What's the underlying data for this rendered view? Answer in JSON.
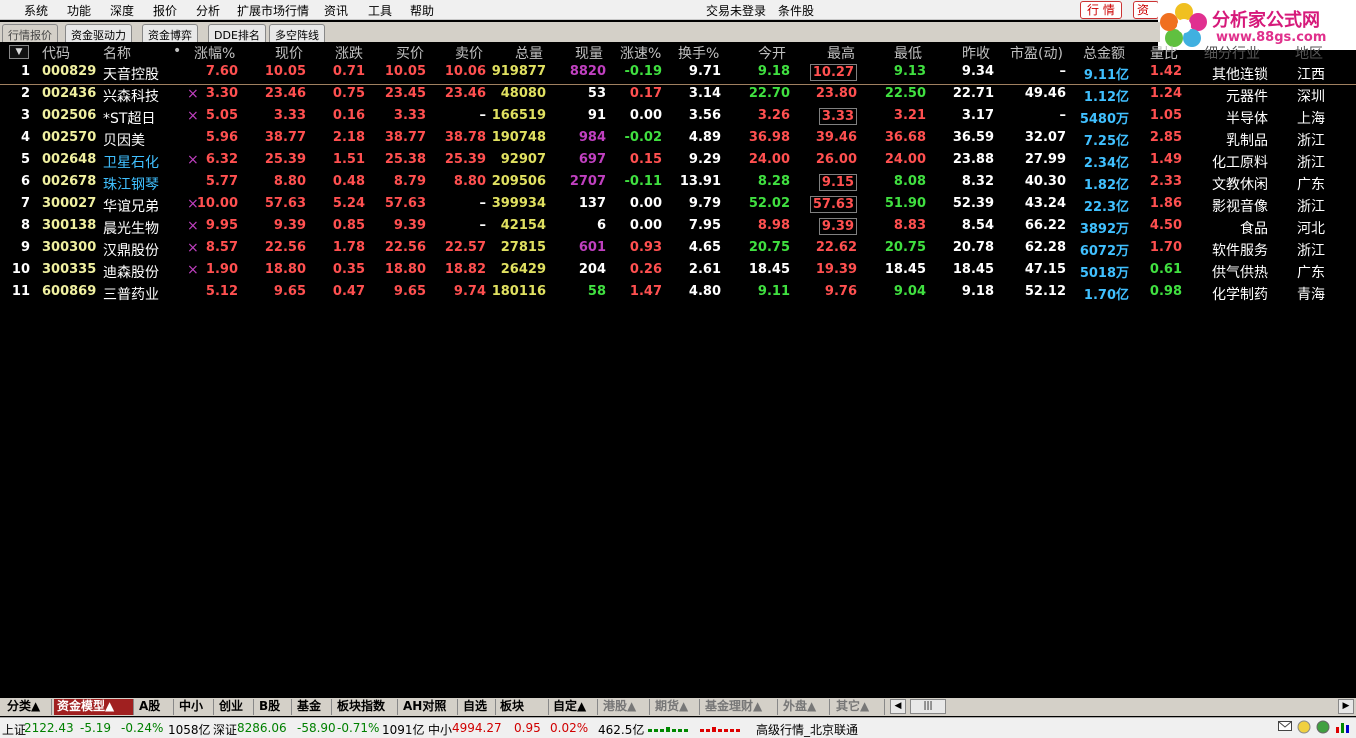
{
  "menu": {
    "items": [
      "系统",
      "功能",
      "深度",
      "报价",
      "分析",
      "扩展市场行情",
      "资讯",
      "工具",
      "帮助"
    ],
    "center_left": "交易未登录",
    "center_right": "条件股",
    "btn_quote": "行 情",
    "btn_info": "资"
  },
  "logo": {
    "title": "分析家公式网",
    "url": "www.88gs.com"
  },
  "tabs": [
    "行情报价",
    "资金驱动力",
    "资金博弈",
    "DDE排名",
    "多空阵线"
  ],
  "columns": [
    "代码",
    "名称",
    "•",
    "涨幅%",
    "现价",
    "涨跌",
    "买价",
    "卖价",
    "总量",
    "现量",
    "涨速%",
    "换手%",
    "今开",
    "最高",
    "最低",
    "昨收",
    "市盈(动)",
    "总金额",
    "量比",
    "细分行业",
    "地区"
  ],
  "sort_icon": "sort-desc-icon",
  "rows": [
    {
      "n": "1",
      "code": "000829",
      "name": "天音控股",
      "mark": "",
      "chg": "7.60",
      "price": "10.05",
      "diff": "0.71",
      "bid": "10.05",
      "ask": "10.06",
      "vol": "919877",
      "cur": "8820",
      "spd": "-0.19",
      "turn": "9.71",
      "open": "9.18",
      "high": "10.27",
      "low": "9.13",
      "prev": "9.34",
      "pe": "–",
      "amt": "9.11亿",
      "ratio": "1.42",
      "ind": "其他连锁",
      "area": "江西"
    },
    {
      "n": "2",
      "code": "002436",
      "name": "兴森科技",
      "mark": "×",
      "chg": "3.30",
      "price": "23.46",
      "diff": "0.75",
      "bid": "23.45",
      "ask": "23.46",
      "vol": "48080",
      "cur": "53",
      "spd": "0.17",
      "turn": "3.14",
      "open": "22.70",
      "high": "23.80",
      "low": "22.50",
      "prev": "22.71",
      "pe": "49.46",
      "amt": "1.12亿",
      "ratio": "1.24",
      "ind": "元器件",
      "area": "深圳"
    },
    {
      "n": "3",
      "code": "002506",
      "name": "*ST超日",
      "mark": "×",
      "chg": "5.05",
      "price": "3.33",
      "diff": "0.16",
      "bid": "3.33",
      "ask": "–",
      "vol": "166519",
      "cur": "91",
      "spd": "0.00",
      "turn": "3.56",
      "open": "3.26",
      "high": "3.33",
      "low": "3.21",
      "prev": "3.17",
      "pe": "–",
      "amt": "5480万",
      "ratio": "1.05",
      "ind": "半导体",
      "area": "上海"
    },
    {
      "n": "4",
      "code": "002570",
      "name": "贝因美",
      "mark": "",
      "chg": "5.96",
      "price": "38.77",
      "diff": "2.18",
      "bid": "38.77",
      "ask": "38.78",
      "vol": "190748",
      "cur": "984",
      "spd": "-0.02",
      "turn": "4.89",
      "open": "36.98",
      "high": "39.46",
      "low": "36.68",
      "prev": "36.59",
      "pe": "32.07",
      "amt": "7.25亿",
      "ratio": "2.85",
      "ind": "乳制品",
      "area": "浙江"
    },
    {
      "n": "5",
      "code": "002648",
      "name": "卫星石化",
      "mark": "×",
      "chg": "6.32",
      "price": "25.39",
      "diff": "1.51",
      "bid": "25.38",
      "ask": "25.39",
      "vol": "92907",
      "cur": "697",
      "spd": "0.15",
      "turn": "9.29",
      "open": "24.00",
      "high": "26.00",
      "low": "24.00",
      "prev": "23.88",
      "pe": "27.99",
      "amt": "2.34亿",
      "ratio": "1.49",
      "ind": "化工原料",
      "area": "浙江"
    },
    {
      "n": "6",
      "code": "002678",
      "name": "珠江钢琴",
      "mark": "",
      "chg": "5.77",
      "price": "8.80",
      "diff": "0.48",
      "bid": "8.79",
      "ask": "8.80",
      "vol": "209506",
      "cur": "2707",
      "spd": "-0.11",
      "turn": "13.91",
      "open": "8.28",
      "high": "9.15",
      "low": "8.08",
      "prev": "8.32",
      "pe": "40.30",
      "amt": "1.82亿",
      "ratio": "2.33",
      "ind": "文教休闲",
      "area": "广东"
    },
    {
      "n": "7",
      "code": "300027",
      "name": "华谊兄弟",
      "mark": "×",
      "chg": "10.00",
      "price": "57.63",
      "diff": "5.24",
      "bid": "57.63",
      "ask": "–",
      "vol": "399934",
      "cur": "137",
      "spd": "0.00",
      "turn": "9.79",
      "open": "52.02",
      "high": "57.63",
      "low": "51.90",
      "prev": "52.39",
      "pe": "43.24",
      "amt": "22.3亿",
      "ratio": "1.86",
      "ind": "影视音像",
      "area": "浙江"
    },
    {
      "n": "8",
      "code": "300138",
      "name": "晨光生物",
      "mark": "×",
      "chg": "9.95",
      "price": "9.39",
      "diff": "0.85",
      "bid": "9.39",
      "ask": "–",
      "vol": "42154",
      "cur": "6",
      "spd": "0.00",
      "turn": "7.95",
      "open": "8.98",
      "high": "9.39",
      "low": "8.83",
      "prev": "8.54",
      "pe": "66.22",
      "amt": "3892万",
      "ratio": "4.50",
      "ind": "食品",
      "area": "河北"
    },
    {
      "n": "9",
      "code": "300300",
      "name": "汉鼎股份",
      "mark": "×",
      "chg": "8.57",
      "price": "22.56",
      "diff": "1.78",
      "bid": "22.56",
      "ask": "22.57",
      "vol": "27815",
      "cur": "601",
      "spd": "0.93",
      "turn": "4.65",
      "open": "20.75",
      "high": "22.62",
      "low": "20.75",
      "prev": "20.78",
      "pe": "62.28",
      "amt": "6072万",
      "ratio": "1.70",
      "ind": "软件服务",
      "area": "浙江"
    },
    {
      "n": "10",
      "code": "300335",
      "name": "迪森股份",
      "mark": "×",
      "chg": "1.90",
      "price": "18.80",
      "diff": "0.35",
      "bid": "18.80",
      "ask": "18.82",
      "vol": "26429",
      "cur": "204",
      "spd": "0.26",
      "turn": "2.61",
      "open": "18.45",
      "high": "19.39",
      "low": "18.45",
      "prev": "18.45",
      "pe": "47.15",
      "amt": "5018万",
      "ratio": "0.61",
      "ind": "供气供热",
      "area": "广东"
    },
    {
      "n": "11",
      "code": "600869",
      "name": "三普药业",
      "mark": "",
      "chg": "5.12",
      "price": "9.65",
      "diff": "0.47",
      "bid": "9.65",
      "ask": "9.74",
      "vol": "180116",
      "cur": "58",
      "spd": "1.47",
      "turn": "4.80",
      "open": "9.11",
      "high": "9.76",
      "low": "9.04",
      "prev": "9.18",
      "pe": "52.12",
      "amt": "1.70亿",
      "ratio": "0.98",
      "ind": "化学制药",
      "area": "青海"
    }
  ],
  "bottom_tabs": [
    "分类▲",
    "资金模型▲",
    "A股",
    "中小",
    "创业",
    "B股",
    "基金",
    "板块指数",
    "AH对照",
    "自选",
    "板块",
    "自定▲",
    "港股▲",
    "期货▲",
    "基金理财▲",
    "外盘▲",
    "其它▲"
  ],
  "status": {
    "sh_label": "上证",
    "sh_val": "2122.43",
    "sh_chg": "-5.19",
    "sh_pct": "-0.24%",
    "sh_amt": "1058亿",
    "sz_label": "深证",
    "sz_val": "8286.06",
    "sz_chg": "-58.90",
    "sz_pct": "-0.71%",
    "sz_amt": "1091亿",
    "zx_label": "中小",
    "zx_val": "4994.27",
    "zx_chg": "0.95",
    "zx_pct": "0.02%",
    "zx_amt": "462.5亿",
    "conn": "高级行情_北京联通"
  },
  "colors": {
    "up": "#ff5050",
    "down": "#40e040",
    "volume": "#e0e060",
    "current_vol": "#c040c0",
    "amount": "#40c0ff"
  }
}
